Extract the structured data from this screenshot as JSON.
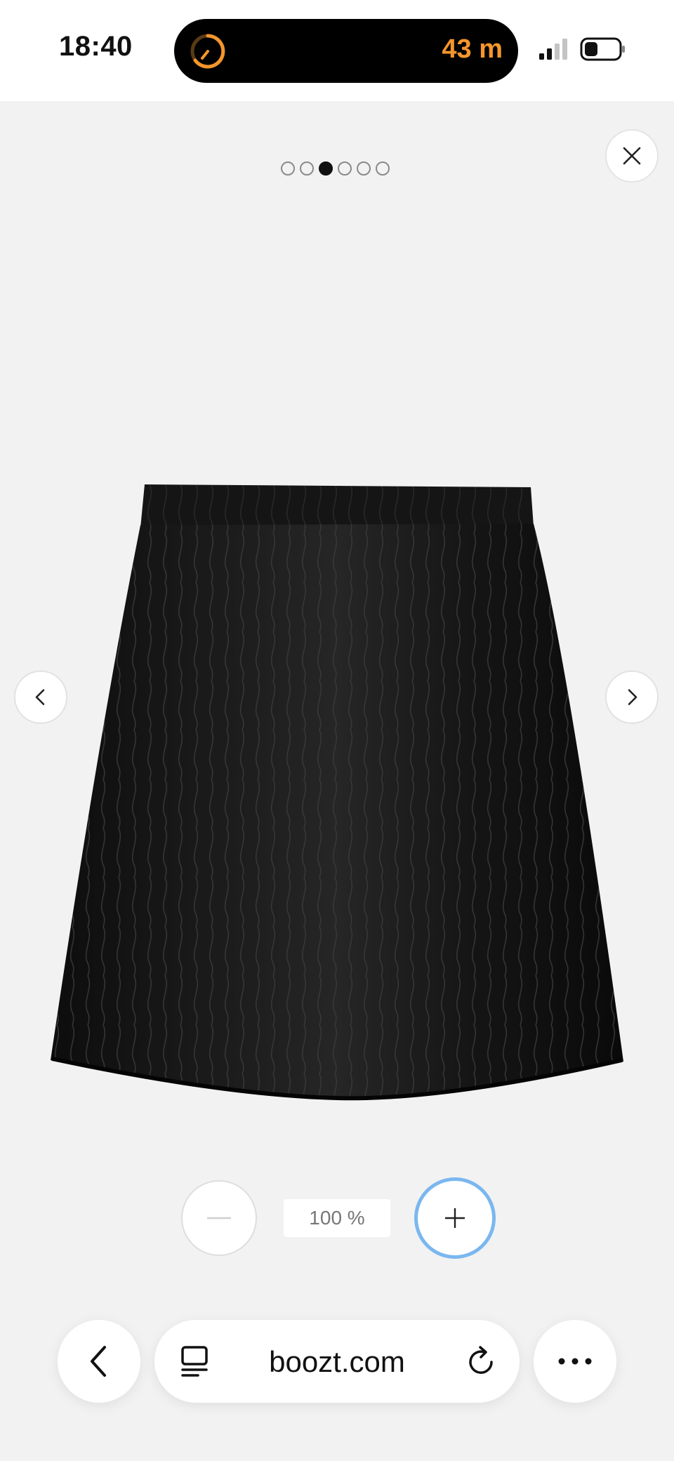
{
  "status_bar": {
    "time": "18:40",
    "island_label": "43 m",
    "accent_color": "#f5962c"
  },
  "gallery": {
    "image_count": 6,
    "active_index": 2,
    "product": "black textured mini skirt"
  },
  "zoom": {
    "level": "100 %"
  },
  "browser": {
    "url": "boozt.com"
  }
}
